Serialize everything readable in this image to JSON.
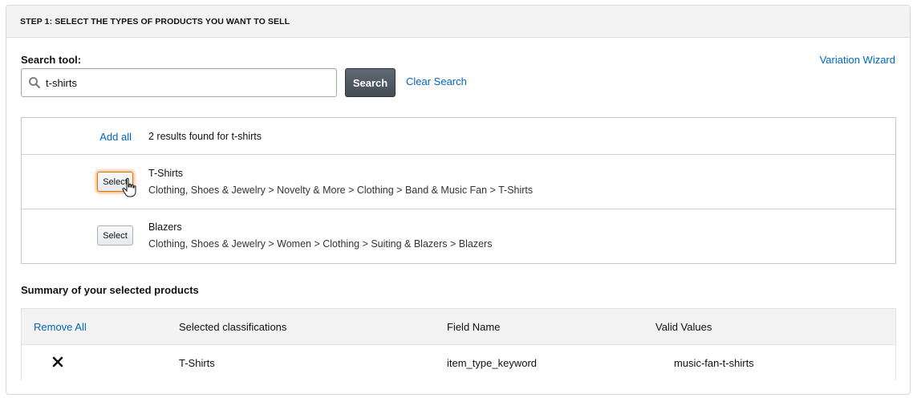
{
  "header": {
    "title": "STEP 1: SELECT THE TYPES OF PRODUCTS YOU WANT TO SELL"
  },
  "search": {
    "label": "Search tool:",
    "value": "t-shirts",
    "button_label": "Search",
    "clear_label": "Clear Search",
    "icon": "search-icon"
  },
  "variation_wizard_label": "Variation Wizard",
  "results": {
    "add_all_label": "Add all",
    "count_text": "2 results found for t-shirts",
    "items": [
      {
        "select_label": "Select",
        "name": "T-Shirts",
        "path": "Clothing, Shoes & Jewelry > Novelty & More > Clothing > Band & Music Fan > T-Shirts"
      },
      {
        "select_label": "Select",
        "name": "Blazers",
        "path": "Clothing, Shoes & Jewelry > Women > Clothing > Suiting & Blazers > Blazers"
      }
    ]
  },
  "summary": {
    "title": "Summary of your selected products",
    "columns": {
      "remove_all": "Remove All",
      "classifications": "Selected classifications",
      "field_name": "Field Name",
      "valid_values": "Valid Values"
    },
    "rows": [
      {
        "remove_icon": "close-icon",
        "classification": "T-Shirts",
        "field_name": "item_type_keyword",
        "valid_value": "music-fan-t-shirts"
      }
    ]
  },
  "colors": {
    "link": "#0066c0",
    "search_button": "#4f5861",
    "focus": "#e77600",
    "header_bg": "#f3f3f3"
  }
}
